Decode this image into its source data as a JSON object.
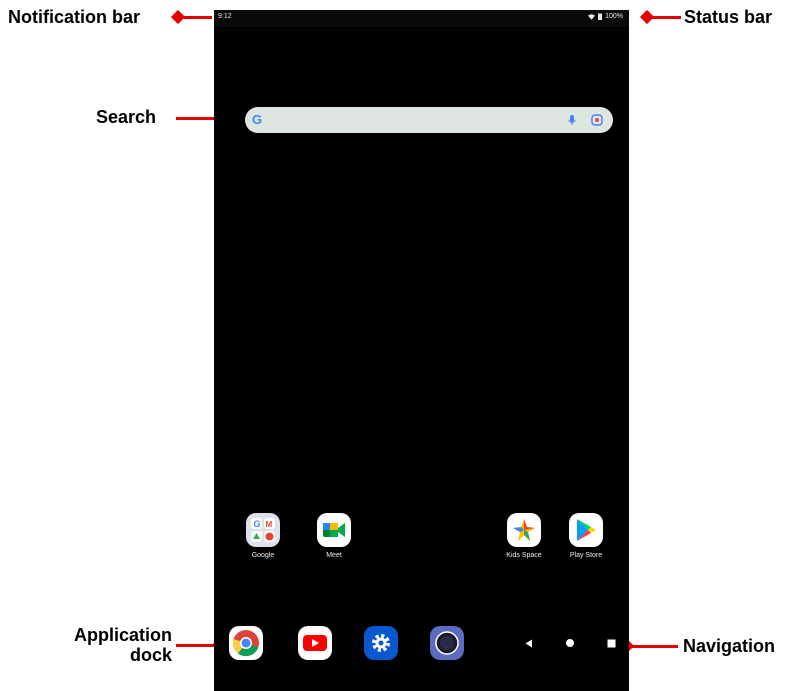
{
  "callouts": {
    "notification_bar": "Notification bar",
    "status_bar": "Status bar",
    "search": "Search",
    "application_dock_line1": "Application",
    "application_dock_line2": "dock",
    "navigation": "Navigation"
  },
  "statusbar": {
    "time": "9:12",
    "battery": "100%",
    "icons": [
      "wifi-icon",
      "battery-icon"
    ]
  },
  "search": {
    "logo": "G",
    "icons": [
      "google-logo",
      "mic-icon",
      "lens-icon"
    ]
  },
  "home_apps": [
    {
      "label": "Google",
      "icon": "google-folder-icon"
    },
    {
      "label": "Meet",
      "icon": "meet-icon"
    },
    {
      "label": "Kids Space",
      "icon": "kids-space-icon"
    },
    {
      "label": "Play Store",
      "icon": "play-store-icon"
    }
  ],
  "dock": [
    "chrome-icon",
    "youtube-icon",
    "settings-icon",
    "camera-icon"
  ],
  "navigation": [
    "back-icon",
    "home-icon",
    "recents-icon"
  ],
  "colors": {
    "callout_arrow": "#e60000",
    "screen_bg": "#000000",
    "search_bg": "#dfe5e0"
  }
}
